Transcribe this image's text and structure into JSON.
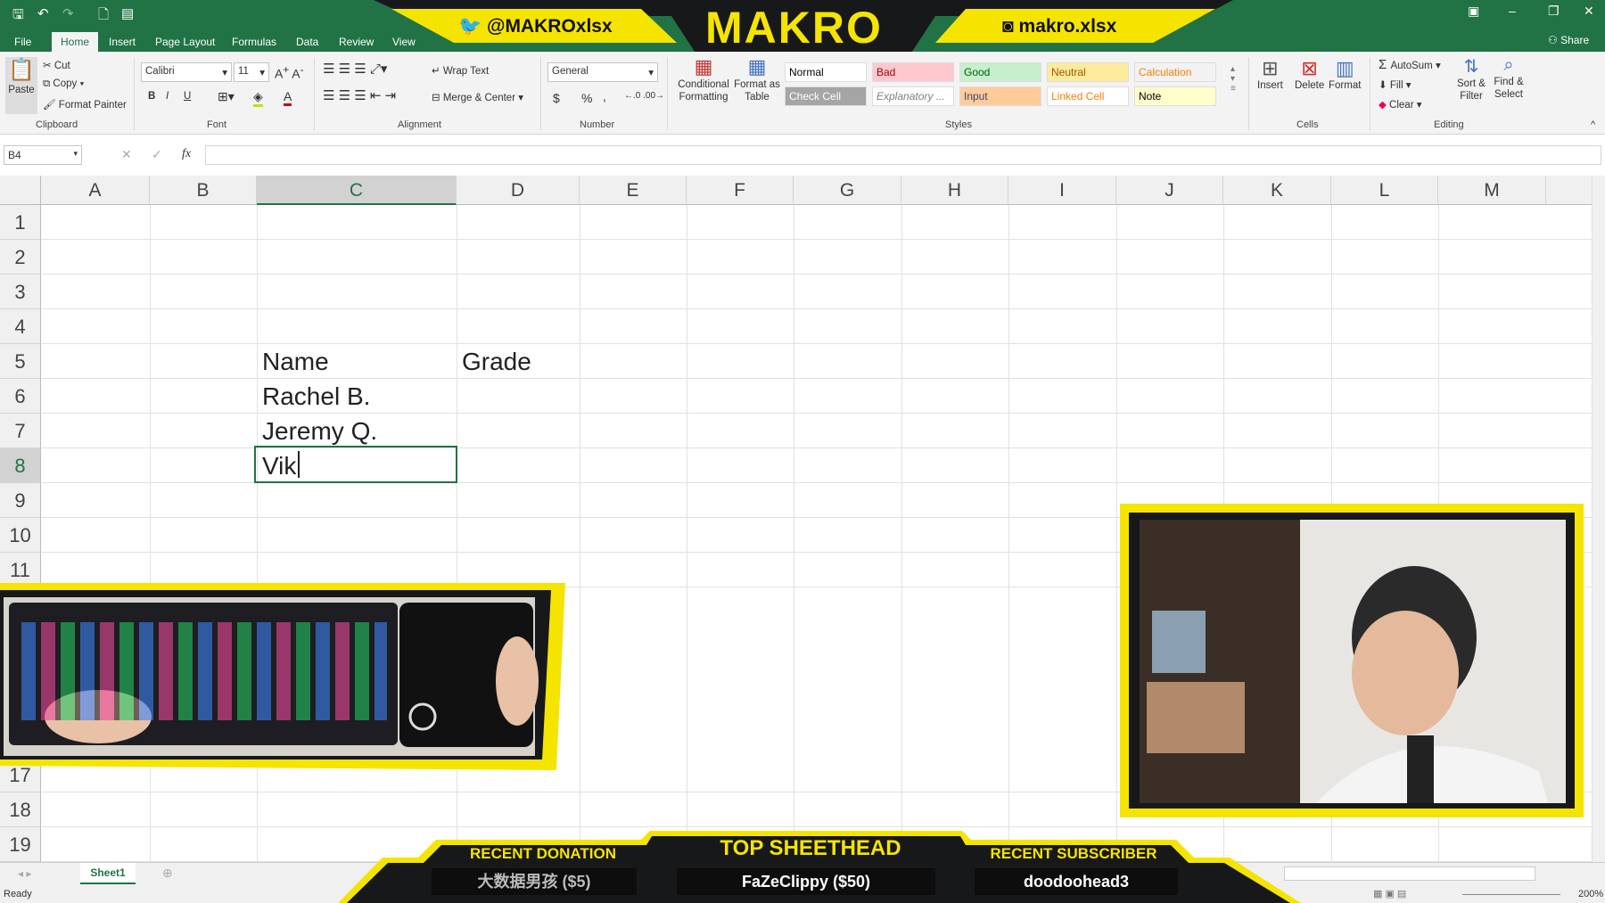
{
  "window": {
    "tabs": [
      "File",
      "Home",
      "Insert",
      "Page Layout",
      "Formulas",
      "Data",
      "Review",
      "View"
    ],
    "active_tab": "Home",
    "share": "Share"
  },
  "overlay_top": {
    "twitter": "@MAKROxlsx",
    "logo": "MAKRO",
    "instagram": "makro.xlsx"
  },
  "ribbon": {
    "clipboard": {
      "paste": "Paste",
      "cut": "Cut",
      "copy": "Copy",
      "format_painter": "Format Painter",
      "label": "Clipboard"
    },
    "font": {
      "name": "Calibri",
      "size": "11",
      "bold": "B",
      "italic": "I",
      "underline": "U",
      "label": "Font"
    },
    "alignment": {
      "wrap": "Wrap Text",
      "merge": "Merge & Center",
      "label": "Alignment"
    },
    "number": {
      "format": "General",
      "currency": "$",
      "percent": "%",
      "comma": ",",
      "label": "Number"
    },
    "styles": {
      "conditional": "Conditional Formatting",
      "format_table": "Format as Table",
      "label": "Styles",
      "items": [
        {
          "label": "Normal",
          "bg": "#ffffff",
          "fg": "#000000"
        },
        {
          "label": "Bad",
          "bg": "#ffc7ce",
          "fg": "#9c0006"
        },
        {
          "label": "Good",
          "bg": "#c6efce",
          "fg": "#006100"
        },
        {
          "label": "Neutral",
          "bg": "#ffeb9c",
          "fg": "#9c5700"
        },
        {
          "label": "Calculation",
          "bg": "#f2f2f2",
          "fg": "#fa7d00"
        },
        {
          "label": "Check Cell",
          "bg": "#a5a5a5",
          "fg": "#ffffff"
        },
        {
          "label": "Explanatory ...",
          "bg": "#ffffff",
          "fg": "#7f7f7f"
        },
        {
          "label": "Input",
          "bg": "#ffcc99",
          "fg": "#3f3f76"
        },
        {
          "label": "Linked Cell",
          "bg": "#ffffff",
          "fg": "#fa7d00"
        },
        {
          "label": "Note",
          "bg": "#ffffcc",
          "fg": "#000000"
        }
      ]
    },
    "cells": {
      "insert": "Insert",
      "delete": "Delete",
      "format": "Format",
      "label": "Cells"
    },
    "editing": {
      "autosum": "AutoSum",
      "fill": "Fill",
      "clear": "Clear",
      "sort": "Sort & Filter",
      "find": "Find & Select",
      "label": "Editing"
    }
  },
  "formula_bar": {
    "name_box": "B4",
    "fx": "fx",
    "value": ""
  },
  "grid": {
    "columns": [
      "A",
      "B",
      "C",
      "D",
      "E",
      "F",
      "G",
      "H",
      "I",
      "J",
      "K",
      "L",
      "M"
    ],
    "selected_column": "C",
    "rows": [
      "1",
      "2",
      "3",
      "4",
      "5",
      "6",
      "7",
      "8",
      "9",
      "10",
      "11",
      "17",
      "18",
      "19"
    ],
    "active_row": "8",
    "cells": {
      "C5": "Name",
      "D5": "Grade",
      "C6": "Rachel B.",
      "C7": "Jeremy Q.",
      "C8": "Vik"
    }
  },
  "sheets": [
    "Sheet1"
  ],
  "status": {
    "text": "Ready",
    "zoom": "200%"
  },
  "overlay_bottom": {
    "donation_title": "RECENT DONATION",
    "donation": "大数据男孩 ($5)",
    "top_title": "TOP SHEETHEAD",
    "top": "FaZeClippy ($50)",
    "sub_title": "RECENT SUBSCRIBER",
    "sub": "doodoohead3"
  },
  "colors": {
    "excel_green": "#217346",
    "overlay_yellow": "#f5e400",
    "overlay_dark": "#17181a"
  }
}
